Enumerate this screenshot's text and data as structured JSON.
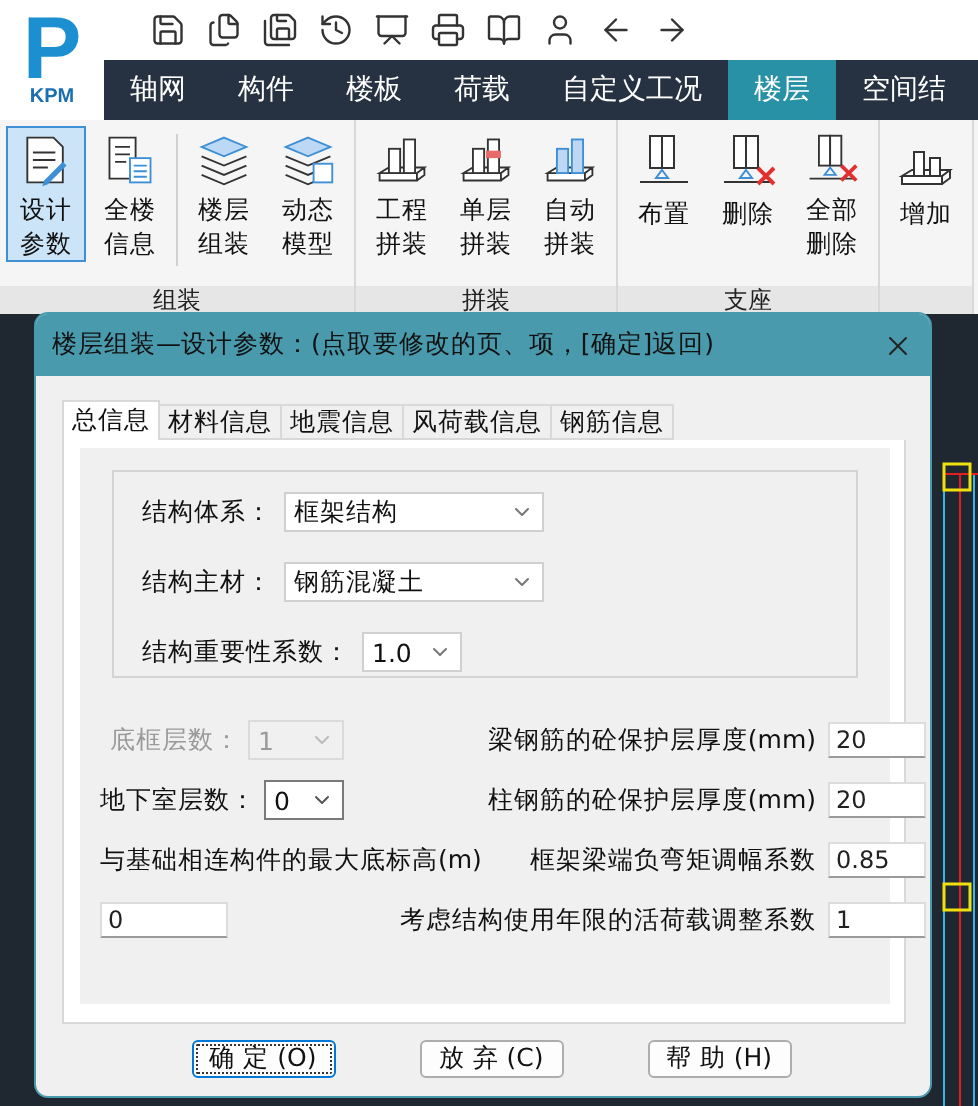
{
  "logo": {
    "letter": "P",
    "text": "KPM"
  },
  "menu": [
    {
      "label": "轴网",
      "selected": false
    },
    {
      "label": "构件",
      "selected": false
    },
    {
      "label": "楼板",
      "selected": false
    },
    {
      "label": "荷载",
      "selected": false
    },
    {
      "label": "自定义工况",
      "selected": false
    },
    {
      "label": "楼层",
      "selected": true
    },
    {
      "label": "空间结",
      "selected": false
    }
  ],
  "ribbon": [
    {
      "label": "组装",
      "buttons": [
        {
          "label": "设计参数",
          "selected": true
        },
        {
          "label": "全楼信息",
          "selected": false
        },
        {
          "label": "楼层组装",
          "selected": false
        },
        {
          "label": "动态模型",
          "selected": false
        }
      ]
    },
    {
      "label": "拼装",
      "buttons": [
        {
          "label": "工程拼装",
          "selected": false
        },
        {
          "label": "单层拼装",
          "selected": false
        },
        {
          "label": "自动拼装",
          "selected": false
        }
      ]
    },
    {
      "label": "支座",
      "buttons": [
        {
          "label": "布置",
          "selected": false
        },
        {
          "label": "删除",
          "selected": false
        },
        {
          "label": "全部删除",
          "selected": false
        }
      ]
    },
    {
      "buttons": [
        {
          "label": "增加",
          "selected": false
        }
      ]
    }
  ],
  "dialog": {
    "title": "楼层组装—设计参数：(点取要修改的页、项，[确定]返回)",
    "tabs": [
      {
        "label": "总信息",
        "selected": true
      },
      {
        "label": "材料信息",
        "selected": false
      },
      {
        "label": "地震信息",
        "selected": false
      },
      {
        "label": "风荷载信息",
        "selected": false
      },
      {
        "label": "钢筋信息",
        "selected": false
      }
    ],
    "group": [
      {
        "label": "结构体系：",
        "value": "框架结构"
      },
      {
        "label": "结构主材：",
        "value": "钢筋混凝土"
      },
      {
        "label": "结构重要性系数：",
        "value": "1.0"
      }
    ],
    "left_fields": [
      {
        "label": "底框层数：",
        "value": "1",
        "disabled": true
      },
      {
        "label": "地下室层数：",
        "value": "0",
        "disabled": false
      }
    ],
    "base_elevation": {
      "label": "与基础相连构件的最大底标高(m)",
      "value": "0"
    },
    "right_fields": [
      {
        "label": "梁钢筋的砼保护层厚度(mm)",
        "value": "20"
      },
      {
        "label": "柱钢筋的砼保护层厚度(mm)",
        "value": "20"
      },
      {
        "label": "框架梁端负弯矩调幅系数",
        "value": "0.85"
      },
      {
        "label": "考虑结构使用年限的活荷载调整系数",
        "value": "1"
      }
    ],
    "buttons": [
      {
        "label": "确 定 (O)",
        "default": true
      },
      {
        "label": "放 弃 (C)",
        "default": false
      },
      {
        "label": "帮 助 (H)",
        "default": false
      }
    ]
  }
}
